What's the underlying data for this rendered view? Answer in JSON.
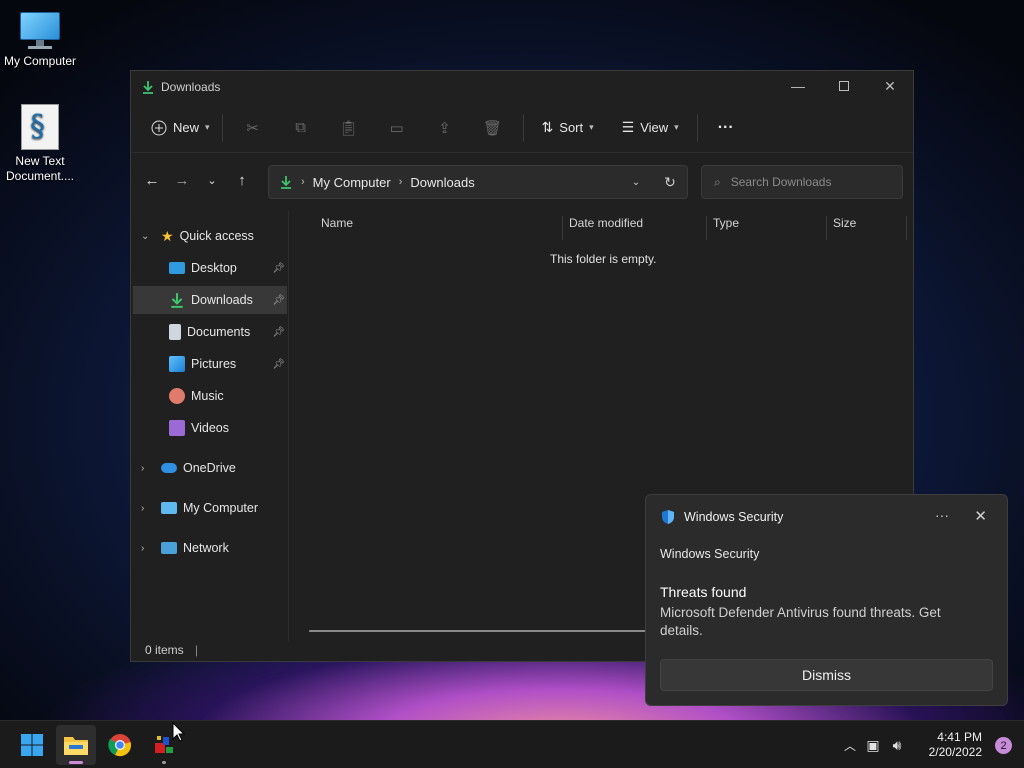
{
  "desktop": {
    "icons": [
      {
        "label": "My Computer"
      },
      {
        "label": "New Text Document...."
      }
    ]
  },
  "explorer": {
    "title": "Downloads",
    "toolbar": {
      "new_label": "New",
      "sort_label": "Sort",
      "view_label": "View",
      "more_label": "···"
    },
    "breadcrumb": [
      "My Computer",
      "Downloads"
    ],
    "search_placeholder": "Search Downloads",
    "nav": {
      "quick_access": "Quick access",
      "items": [
        {
          "label": "Desktop",
          "icon": "desktop-icon",
          "pinned": true
        },
        {
          "label": "Downloads",
          "icon": "download-icon",
          "pinned": true,
          "selected": true
        },
        {
          "label": "Documents",
          "icon": "documents-icon",
          "pinned": true
        },
        {
          "label": "Pictures",
          "icon": "pictures-icon",
          "pinned": true
        },
        {
          "label": "Music",
          "icon": "music-icon",
          "pinned": false
        },
        {
          "label": "Videos",
          "icon": "videos-icon",
          "pinned": false
        }
      ],
      "onedrive": "OneDrive",
      "mycomputer": "My Computer",
      "network": "Network"
    },
    "columns": [
      "Name",
      "Date modified",
      "Type",
      "Size"
    ],
    "empty_message": "This folder is empty.",
    "status": "0 items"
  },
  "toast": {
    "app_name": "Windows Security",
    "subtitle": "Windows Security",
    "title": "Threats found",
    "body": "Microsoft Defender Antivirus found threats. Get details.",
    "button": "Dismiss"
  },
  "taskbar": {
    "time": "4:41 PM",
    "date": "2/20/2022",
    "notifications": "2"
  },
  "colors": {
    "accent": "#60cdff",
    "download_green": "#3ec46d",
    "badge": "#c78bd9"
  }
}
